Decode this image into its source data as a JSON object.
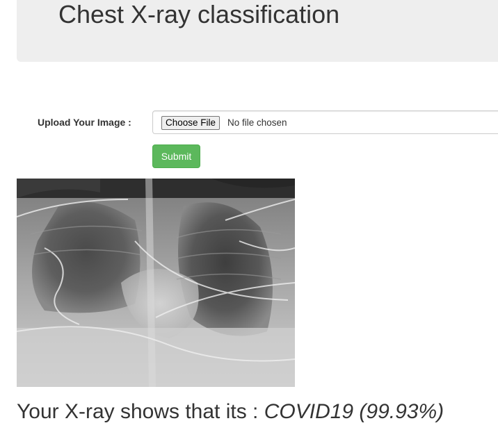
{
  "header": {
    "title": "Chest X-ray classification"
  },
  "form": {
    "upload_label": "Upload Your Image :",
    "choose_file_label": "Choose File",
    "file_status": "No file chosen",
    "submit_label": "Submit"
  },
  "result": {
    "prefix": "Your X-ray shows that its :",
    "prediction": "COVID19 (99.93%)"
  },
  "colors": {
    "jumbotron_bg": "#eeeeee",
    "submit_bg": "#5cb85c",
    "text": "#333333"
  }
}
